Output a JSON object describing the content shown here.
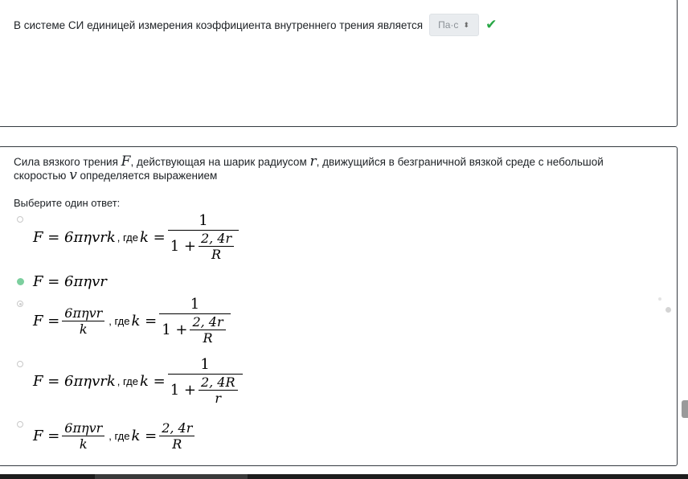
{
  "q1": {
    "text": "В системе СИ единицей измерения коэффициента  внутреннего трения является",
    "selected_value": "Па·с",
    "select_chevron": "⬍",
    "check_mark": "✔",
    "colors": {
      "check": "#28a745"
    }
  },
  "q2": {
    "text_a": "Сила вязкого трения ",
    "var_F": "F",
    "text_b": ", действующая на шарик радиусом ",
    "var_r": "r",
    "text_c": ", движущийся в безграничной вязкой среде с небольшой скоростью ",
    "var_v": "v",
    "text_d": " определяется выражением",
    "prompt": "Выберите один ответ:",
    "options": [
      {
        "state": "unselected",
        "lhs": "F = 6πηvrk",
        "where": ", где",
        "k_eq": "k =",
        "num": "1",
        "den_pre": "1 +",
        "inner_num": "2, 4r",
        "inner_den": "R"
      },
      {
        "state": "selected",
        "lhs": "F = 6πηvr"
      },
      {
        "state": "hover",
        "lhs": "F =",
        "frac_num": "6πηvr",
        "frac_den": "k",
        "where": ", где",
        "k_eq": "k =",
        "num": "1",
        "den_pre": "1 +",
        "inner_num": "2, 4r",
        "inner_den": "R"
      },
      {
        "state": "unselected",
        "lhs": "F = 6πηvrk",
        "where": ", где",
        "k_eq": "k =",
        "num": "1",
        "den_pre": "1 +",
        "inner_num": "2, 4R",
        "inner_den": "r"
      },
      {
        "state": "unselected",
        "lhs": "F =",
        "frac_num": "6πηvr",
        "frac_den": "k",
        "where": ", где",
        "k_eq": "k =",
        "num": "2, 4r",
        "den": "R"
      }
    ],
    "colors": {
      "selected_radio": "#7ccf9e"
    }
  }
}
